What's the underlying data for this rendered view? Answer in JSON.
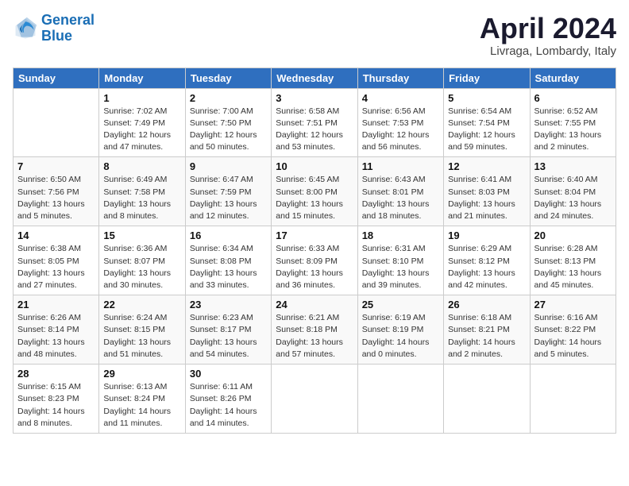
{
  "logo": {
    "line1": "General",
    "line2": "Blue"
  },
  "title": "April 2024",
  "location": "Livraga, Lombardy, Italy",
  "weekdays": [
    "Sunday",
    "Monday",
    "Tuesday",
    "Wednesday",
    "Thursday",
    "Friday",
    "Saturday"
  ],
  "weeks": [
    [
      {
        "num": "",
        "info": ""
      },
      {
        "num": "1",
        "info": "Sunrise: 7:02 AM\nSunset: 7:49 PM\nDaylight: 12 hours\nand 47 minutes."
      },
      {
        "num": "2",
        "info": "Sunrise: 7:00 AM\nSunset: 7:50 PM\nDaylight: 12 hours\nand 50 minutes."
      },
      {
        "num": "3",
        "info": "Sunrise: 6:58 AM\nSunset: 7:51 PM\nDaylight: 12 hours\nand 53 minutes."
      },
      {
        "num": "4",
        "info": "Sunrise: 6:56 AM\nSunset: 7:53 PM\nDaylight: 12 hours\nand 56 minutes."
      },
      {
        "num": "5",
        "info": "Sunrise: 6:54 AM\nSunset: 7:54 PM\nDaylight: 12 hours\nand 59 minutes."
      },
      {
        "num": "6",
        "info": "Sunrise: 6:52 AM\nSunset: 7:55 PM\nDaylight: 13 hours\nand 2 minutes."
      }
    ],
    [
      {
        "num": "7",
        "info": "Sunrise: 6:50 AM\nSunset: 7:56 PM\nDaylight: 13 hours\nand 5 minutes."
      },
      {
        "num": "8",
        "info": "Sunrise: 6:49 AM\nSunset: 7:58 PM\nDaylight: 13 hours\nand 8 minutes."
      },
      {
        "num": "9",
        "info": "Sunrise: 6:47 AM\nSunset: 7:59 PM\nDaylight: 13 hours\nand 12 minutes."
      },
      {
        "num": "10",
        "info": "Sunrise: 6:45 AM\nSunset: 8:00 PM\nDaylight: 13 hours\nand 15 minutes."
      },
      {
        "num": "11",
        "info": "Sunrise: 6:43 AM\nSunset: 8:01 PM\nDaylight: 13 hours\nand 18 minutes."
      },
      {
        "num": "12",
        "info": "Sunrise: 6:41 AM\nSunset: 8:03 PM\nDaylight: 13 hours\nand 21 minutes."
      },
      {
        "num": "13",
        "info": "Sunrise: 6:40 AM\nSunset: 8:04 PM\nDaylight: 13 hours\nand 24 minutes."
      }
    ],
    [
      {
        "num": "14",
        "info": "Sunrise: 6:38 AM\nSunset: 8:05 PM\nDaylight: 13 hours\nand 27 minutes."
      },
      {
        "num": "15",
        "info": "Sunrise: 6:36 AM\nSunset: 8:07 PM\nDaylight: 13 hours\nand 30 minutes."
      },
      {
        "num": "16",
        "info": "Sunrise: 6:34 AM\nSunset: 8:08 PM\nDaylight: 13 hours\nand 33 minutes."
      },
      {
        "num": "17",
        "info": "Sunrise: 6:33 AM\nSunset: 8:09 PM\nDaylight: 13 hours\nand 36 minutes."
      },
      {
        "num": "18",
        "info": "Sunrise: 6:31 AM\nSunset: 8:10 PM\nDaylight: 13 hours\nand 39 minutes."
      },
      {
        "num": "19",
        "info": "Sunrise: 6:29 AM\nSunset: 8:12 PM\nDaylight: 13 hours\nand 42 minutes."
      },
      {
        "num": "20",
        "info": "Sunrise: 6:28 AM\nSunset: 8:13 PM\nDaylight: 13 hours\nand 45 minutes."
      }
    ],
    [
      {
        "num": "21",
        "info": "Sunrise: 6:26 AM\nSunset: 8:14 PM\nDaylight: 13 hours\nand 48 minutes."
      },
      {
        "num": "22",
        "info": "Sunrise: 6:24 AM\nSunset: 8:15 PM\nDaylight: 13 hours\nand 51 minutes."
      },
      {
        "num": "23",
        "info": "Sunrise: 6:23 AM\nSunset: 8:17 PM\nDaylight: 13 hours\nand 54 minutes."
      },
      {
        "num": "24",
        "info": "Sunrise: 6:21 AM\nSunset: 8:18 PM\nDaylight: 13 hours\nand 57 minutes."
      },
      {
        "num": "25",
        "info": "Sunrise: 6:19 AM\nSunset: 8:19 PM\nDaylight: 14 hours\nand 0 minutes."
      },
      {
        "num": "26",
        "info": "Sunrise: 6:18 AM\nSunset: 8:21 PM\nDaylight: 14 hours\nand 2 minutes."
      },
      {
        "num": "27",
        "info": "Sunrise: 6:16 AM\nSunset: 8:22 PM\nDaylight: 14 hours\nand 5 minutes."
      }
    ],
    [
      {
        "num": "28",
        "info": "Sunrise: 6:15 AM\nSunset: 8:23 PM\nDaylight: 14 hours\nand 8 minutes."
      },
      {
        "num": "29",
        "info": "Sunrise: 6:13 AM\nSunset: 8:24 PM\nDaylight: 14 hours\nand 11 minutes."
      },
      {
        "num": "30",
        "info": "Sunrise: 6:11 AM\nSunset: 8:26 PM\nDaylight: 14 hours\nand 14 minutes."
      },
      {
        "num": "",
        "info": ""
      },
      {
        "num": "",
        "info": ""
      },
      {
        "num": "",
        "info": ""
      },
      {
        "num": "",
        "info": ""
      }
    ]
  ]
}
